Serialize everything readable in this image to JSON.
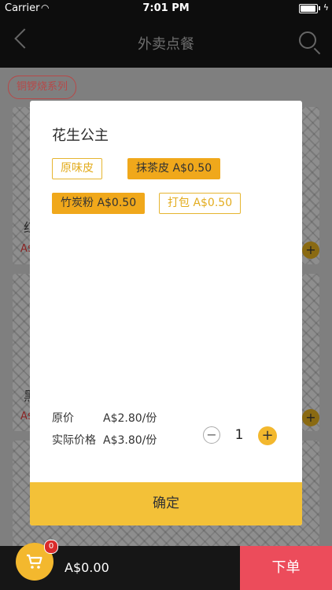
{
  "status": {
    "carrier": "Carrier",
    "time": "7:01 PM"
  },
  "nav": {
    "title": "外卖点餐"
  },
  "background": {
    "category": "铜锣烧系列",
    "card1": {
      "name_fragment": "红",
      "price_fragment": "A$"
    },
    "card2": {
      "name_fragment": "黑",
      "price_fragment": "A$"
    }
  },
  "modal": {
    "product_name": "花生公主",
    "options": [
      {
        "label": "原味皮",
        "selected": false
      },
      {
        "label": "抹茶皮 A$0.50",
        "selected": true
      },
      {
        "label": "竹炭粉 A$0.50",
        "selected": true
      },
      {
        "label": "打包 A$0.50",
        "selected": false
      }
    ],
    "original_price_label": "原价",
    "original_price_value": "A$2.80/份",
    "actual_price_label": "实际价格",
    "actual_price_value": "A$3.80/份",
    "quantity": "1",
    "confirm_label": "确定"
  },
  "cart": {
    "badge_count": "0",
    "total": "A$0.00"
  },
  "order_button": "下单",
  "colors": {
    "accent": "#f3b82e",
    "order": "#ec4c5b",
    "chip_selected": "#f0a81b"
  }
}
